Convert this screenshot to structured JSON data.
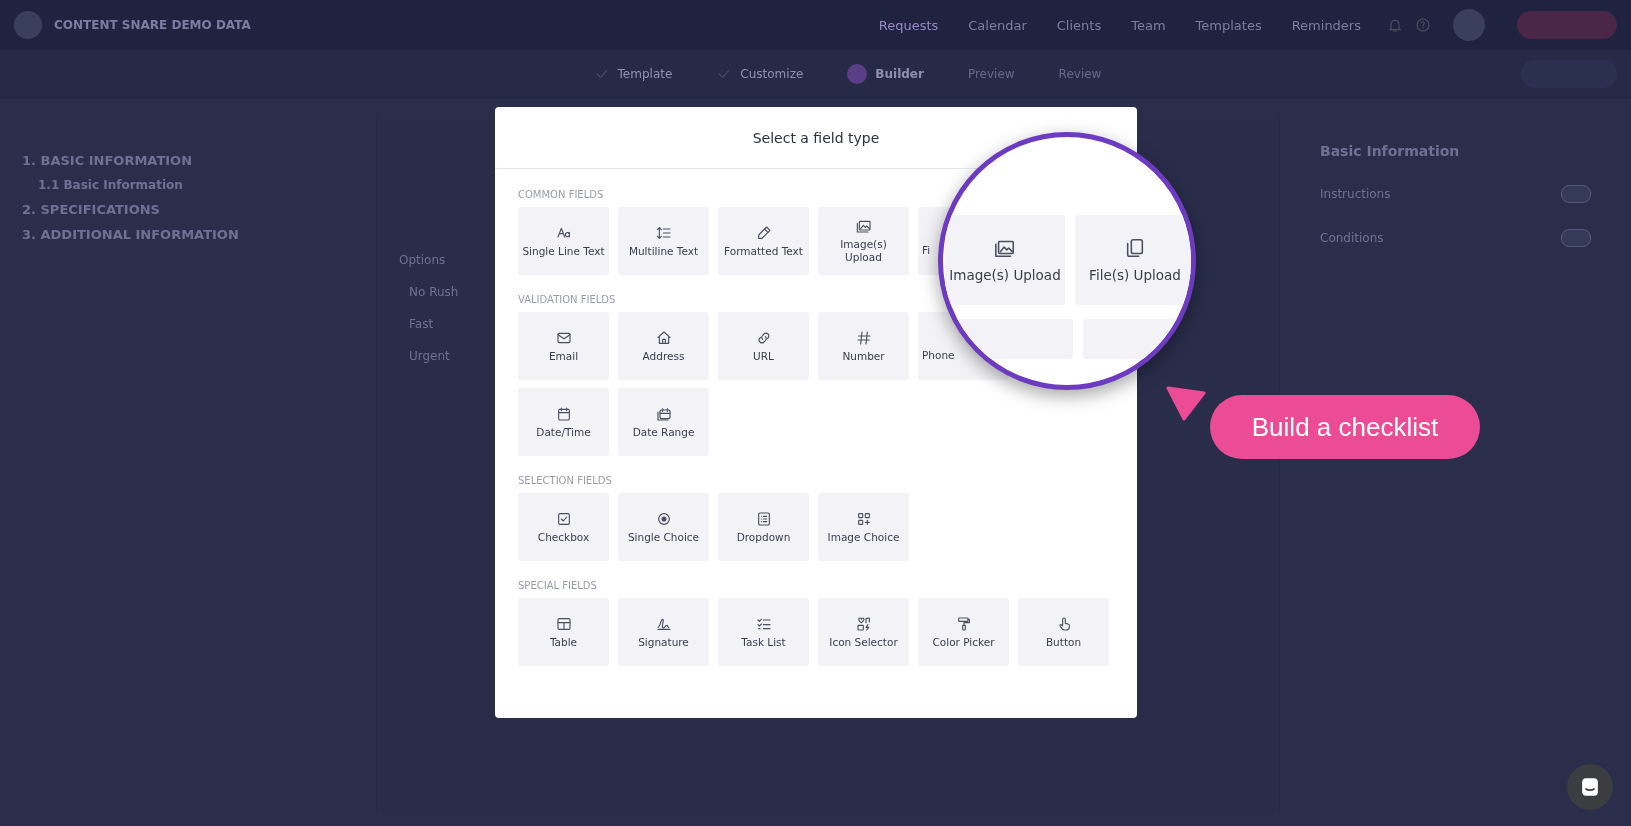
{
  "header": {
    "brand": "CONTENT SNARE DEMO DATA",
    "nav": [
      {
        "label": "Requests",
        "selected": true
      },
      {
        "label": "Calendar",
        "selected": false
      },
      {
        "label": "Clients",
        "selected": false
      },
      {
        "label": "Team",
        "selected": false
      },
      {
        "label": "Templates",
        "selected": false
      },
      {
        "label": "Reminders",
        "selected": false
      }
    ]
  },
  "steps": [
    {
      "label": "Template",
      "completed": true,
      "selected": false
    },
    {
      "label": "Customize",
      "completed": true,
      "selected": false
    },
    {
      "label": "Builder",
      "completed": false,
      "selected": true
    },
    {
      "label": "Preview",
      "completed": false,
      "selected": false
    },
    {
      "label": "Review",
      "completed": false,
      "selected": false
    }
  ],
  "sidebar": {
    "sections": [
      {
        "title": "1. BASIC INFORMATION",
        "children": [
          {
            "title": "1.1 Basic Information"
          }
        ]
      },
      {
        "title": "2. SPECIFICATIONS"
      },
      {
        "title": "3. ADDITIONAL INFORMATION"
      }
    ]
  },
  "editor": {
    "options_label": "Options",
    "options": [
      "No Rush",
      "Fast",
      "Urgent"
    ]
  },
  "right_panel": {
    "title": "Basic Information",
    "toggles": [
      {
        "label": "Instructions",
        "on": false
      },
      {
        "label": "Conditions",
        "on": false
      }
    ]
  },
  "modal": {
    "title": "Select a field type",
    "sections": [
      {
        "title": "COMMON FIELDS",
        "rows": [
          [
            "Single Line Text",
            "Multiline Text",
            "Formatted Text",
            "Image(s) Upload",
            "Fi"
          ]
        ]
      },
      {
        "title": "VALIDATION FIELDS",
        "rows": [
          [
            "Email",
            "Address",
            "URL",
            "Number",
            "Phone"
          ],
          [
            "Date/Time",
            "Date Range"
          ]
        ]
      },
      {
        "title": "SELECTION FIELDS",
        "rows": [
          [
            "Checkbox",
            "Single Choice",
            "Dropdown",
            "Image Choice"
          ]
        ]
      },
      {
        "title": "SPECIAL FIELDS",
        "rows": [
          [
            "Table",
            "Signature",
            "Task List",
            "Icon Selector",
            "Color Picker",
            "Button"
          ]
        ]
      }
    ]
  },
  "magnifier": {
    "tiles": [
      "Image(s) Upload",
      "File(s) Upload"
    ]
  },
  "callout": {
    "text": "Build a checklist"
  }
}
